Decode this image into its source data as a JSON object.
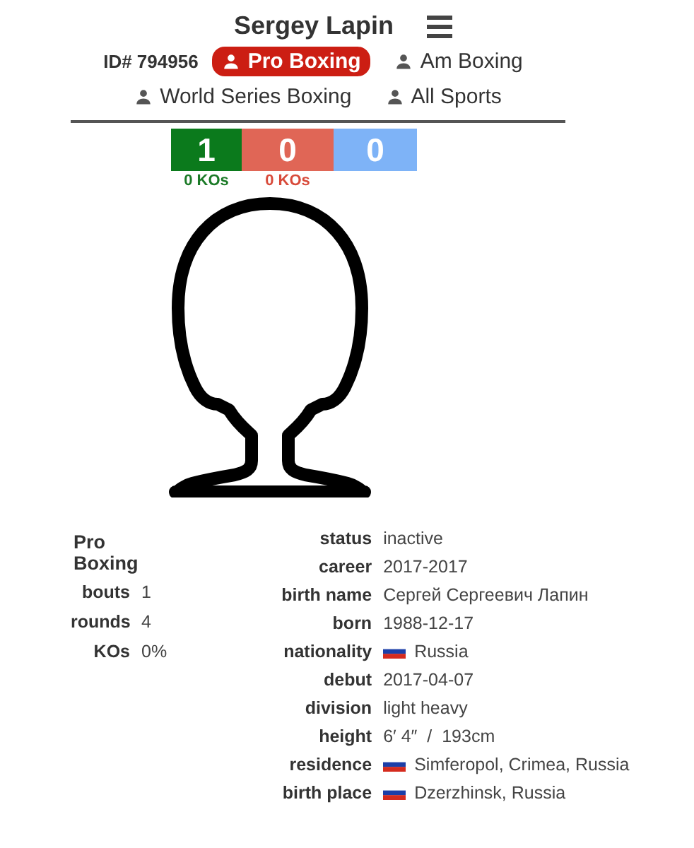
{
  "header": {
    "name": "Sergey Lapin",
    "id_label": "ID# 794956"
  },
  "tabs": [
    {
      "label": "Pro Boxing",
      "selected": true
    },
    {
      "label": "Am Boxing",
      "selected": false
    },
    {
      "label": "World Series Boxing",
      "selected": false
    },
    {
      "label": "All Sports",
      "selected": false
    }
  ],
  "record": [
    {
      "kind": "win",
      "value": "1",
      "kos": "0 KOs"
    },
    {
      "kind": "loss",
      "value": "0",
      "kos": "0 KOs"
    },
    {
      "kind": "draw",
      "value": "0"
    }
  ],
  "summary": {
    "title": "Pro Boxing",
    "rows": [
      {
        "label": "bouts",
        "value": "1"
      },
      {
        "label": "rounds",
        "value": "4"
      },
      {
        "label": "KOs",
        "value": "0%"
      }
    ]
  },
  "profile": [
    {
      "kind": "text",
      "label": "status",
      "value": "inactive"
    },
    {
      "kind": "text",
      "label": "career",
      "value": "2017-2017"
    },
    {
      "kind": "text",
      "label": "birth name",
      "value": "Сергей Сергеевич Лапин"
    },
    {
      "kind": "text",
      "label": "born",
      "value": "1988-12-17"
    },
    {
      "kind": "country",
      "label": "nationality",
      "value": "Russia"
    },
    {
      "kind": "text",
      "label": "debut",
      "value": "2017-04-07"
    },
    {
      "kind": "text",
      "label": "division",
      "value": "light heavy"
    },
    {
      "kind": "text",
      "label": "height",
      "value": "6′ 4″  /  193cm"
    },
    {
      "kind": "country",
      "label": "residence",
      "value": "Simferopol, Crimea, Russia"
    },
    {
      "kind": "country",
      "label": "birth place",
      "value": "Dzerzhinsk, Russia"
    }
  ]
}
